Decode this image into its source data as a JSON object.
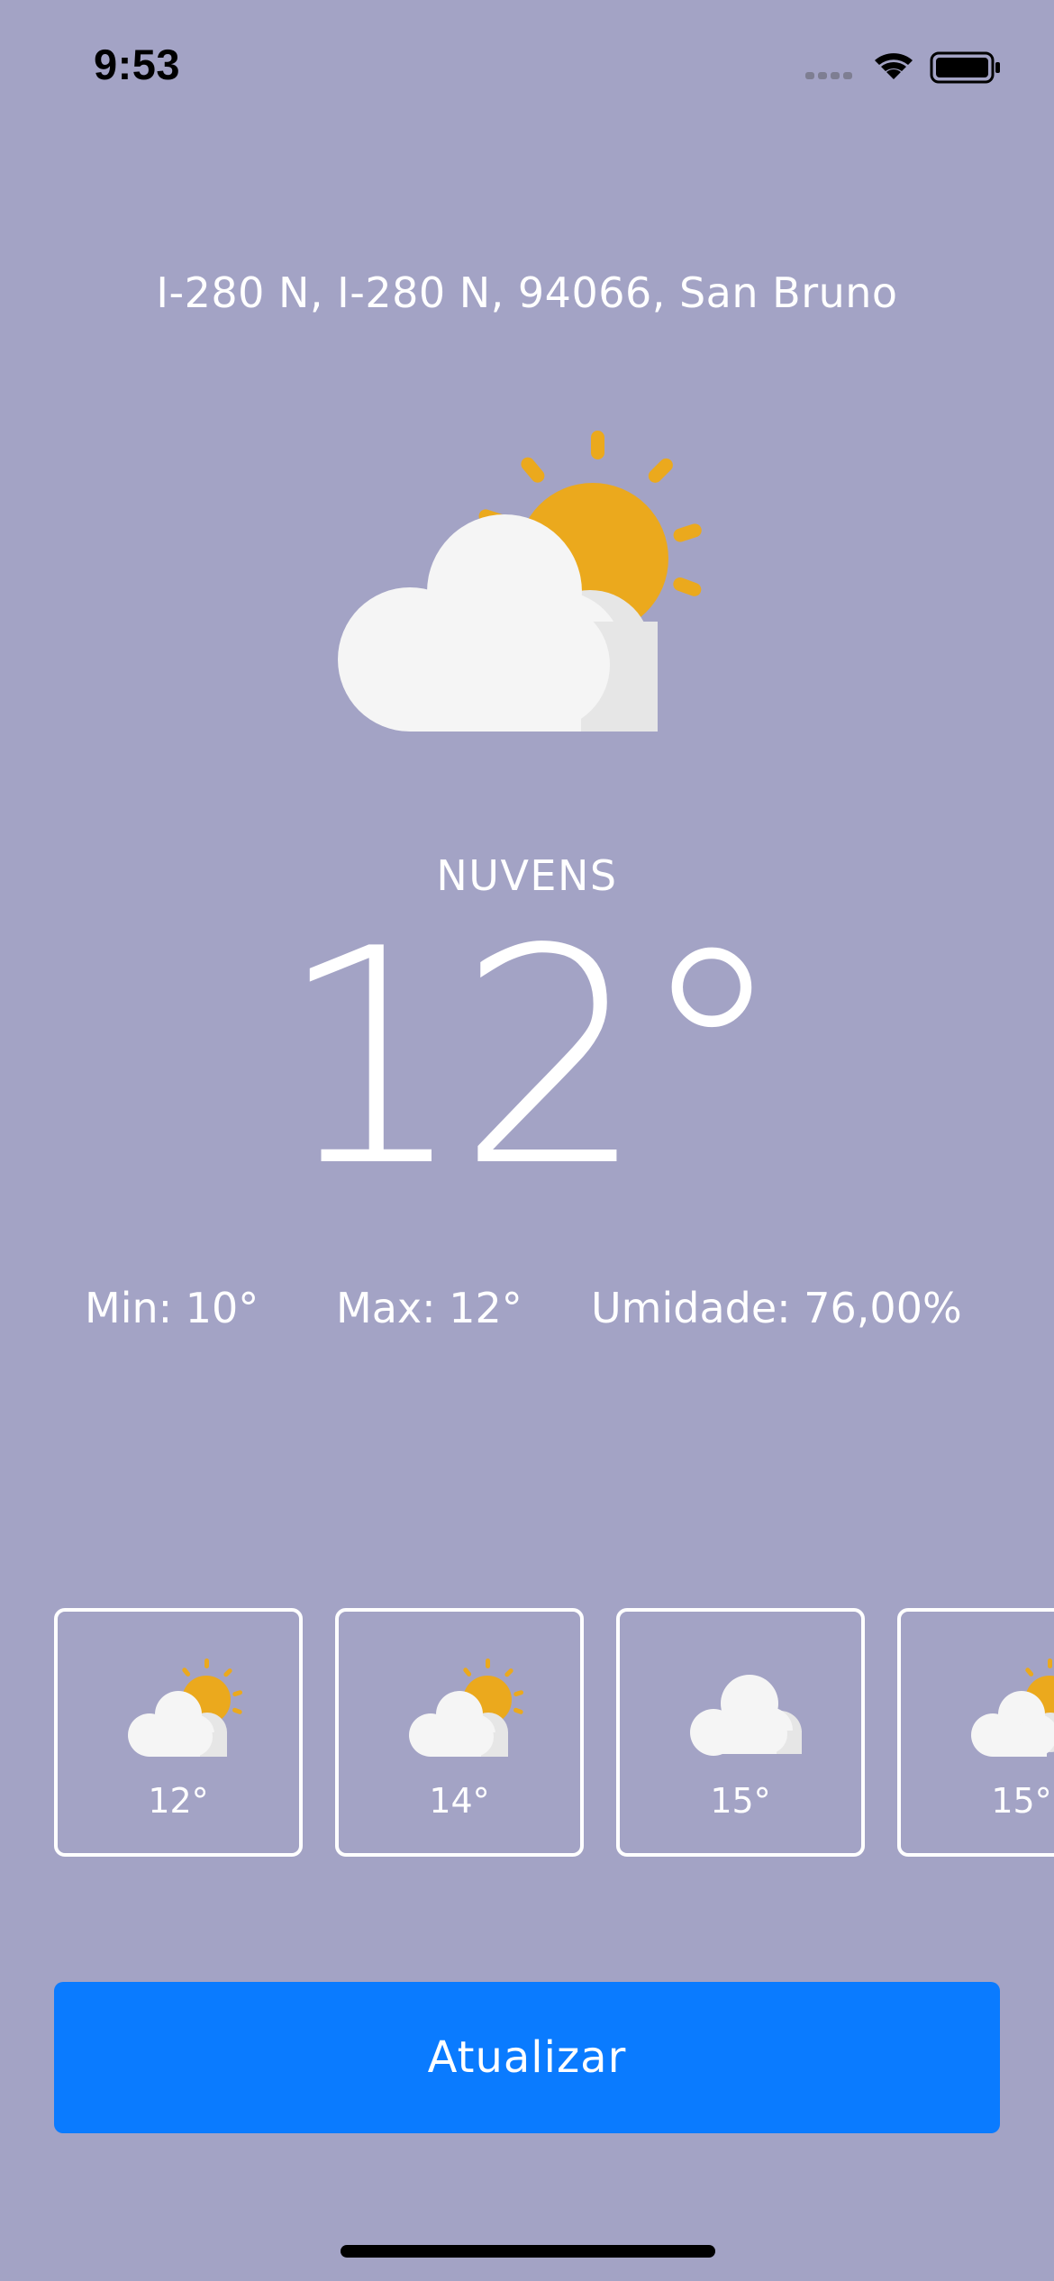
{
  "status_bar": {
    "time": "9:53",
    "icons": [
      "signal-icon",
      "wifi-icon",
      "battery-icon"
    ]
  },
  "location": "I-280 N, I-280 N, 94066, San Bruno",
  "current": {
    "icon": "partly-cloudy-icon",
    "condition": "NUVENS",
    "temperature": "12°"
  },
  "stats": {
    "min": "Min: 10°",
    "max": "Max: 12°",
    "humidity": "Umidade: 76,00%"
  },
  "forecast": [
    {
      "icon": "partly-cloudy-icon",
      "temp": "12°"
    },
    {
      "icon": "partly-cloudy-icon",
      "temp": "14°"
    },
    {
      "icon": "cloud-icon",
      "temp": "15°"
    },
    {
      "icon": "partly-cloudy-icon",
      "temp": "15°"
    }
  ],
  "button": {
    "label": "Atualizar"
  },
  "colors": {
    "background": "#a3a3c5",
    "accent": "#0a7bff",
    "sun": "#eba91d",
    "cloud": "#f5f5f5",
    "cloud_shadow": "#e6e6e6"
  }
}
